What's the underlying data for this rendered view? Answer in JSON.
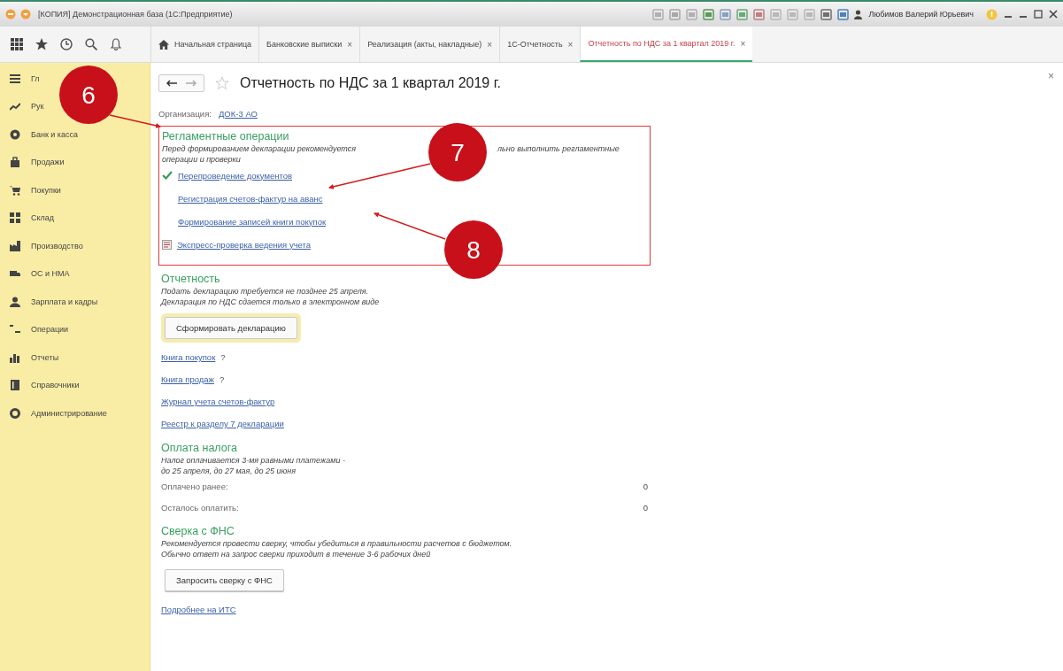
{
  "window": {
    "title": "[КОПИЯ] Демонстрационная база (1С:Предприятие)",
    "user": "Любимов Валерий Юрьевич"
  },
  "tabs": [
    {
      "label": "Начальная страница",
      "home": true,
      "closable": false,
      "selected": false
    },
    {
      "label": "Банковские выписки",
      "home": false,
      "closable": true,
      "selected": false
    },
    {
      "label": "Реализация (акты, накладные)",
      "home": false,
      "closable": true,
      "selected": false
    },
    {
      "label": "1С-Отчетность",
      "home": false,
      "closable": true,
      "selected": false
    },
    {
      "label": "Отчетность по НДС за 1 квартал 2019 г.",
      "home": false,
      "closable": true,
      "selected": true
    }
  ],
  "close_mark": "×",
  "sidebar": {
    "items": [
      {
        "label": "Гл"
      },
      {
        "label": "Рук"
      },
      {
        "label": "Банк и касса"
      },
      {
        "label": "Продажи"
      },
      {
        "label": "Покупки"
      },
      {
        "label": "Склад"
      },
      {
        "label": "Производство"
      },
      {
        "label": "ОС и НМА"
      },
      {
        "label": "Зарплата и кадры"
      },
      {
        "label": "Операции"
      },
      {
        "label": "Отчеты"
      },
      {
        "label": "Справочники"
      },
      {
        "label": "Администрирование"
      }
    ]
  },
  "form": {
    "title": "Отчетность по НДС за 1 квартал 2019 г.",
    "organization_label": "Организация:",
    "organization": "ДОК-3 АО",
    "sections": [
      {
        "heading": "Регламентные операции",
        "highlighted": true,
        "lines": [
          [
            "Перед формированием декларации рекомендуется",
            "льно выполнить регламентные"
          ],
          [
            "операции и проверки"
          ]
        ],
        "items": [
          {
            "kind": "done",
            "label": "Перепроведение документов"
          },
          {
            "kind": "pending",
            "label": "Регистрация счетов-фактур на аванс"
          },
          {
            "kind": "pending",
            "label": "Формирование записей книги покупок"
          },
          {
            "kind": "report",
            "label": "Экспресс-проверка ведения учета"
          }
        ]
      },
      {
        "heading": "Отчетность",
        "highlighted": false,
        "lines": [
          [
            "Подать декларацию требуется не позднее 25 апреля."
          ],
          [
            "Декларация по НДС сдается только в электронном виде"
          ]
        ],
        "items": [
          {
            "kind": "button",
            "label": "Сформировать декларацию",
            "default": true
          },
          {
            "kind": "link",
            "label": "Книга покупок",
            "help": "?"
          },
          {
            "kind": "link",
            "label": "Книга продаж",
            "help": "?"
          },
          {
            "kind": "link",
            "label": "Журнал учета счетов-фактур"
          },
          {
            "kind": "link",
            "label": "Реестр к разделу 7 декларации"
          }
        ]
      },
      {
        "heading": "Оплата налога",
        "highlighted": false,
        "lines": [
          [
            "Налог оплачивается 3-мя равными платежами -"
          ],
          [
            "до 25 апреля, до 27 мая, до 25 июня"
          ]
        ],
        "items": [
          {
            "kind": "amount",
            "label": "Оплачено ранее:",
            "value": "0"
          },
          {
            "kind": "amount",
            "label": "Осталось оплатить:",
            "value": "0"
          }
        ]
      },
      {
        "heading": "Сверка с ФНС",
        "highlighted": false,
        "lines": [
          [
            "Рекомендуется провести сверку, чтобы убедиться в правильности расчетов с бюджетом."
          ],
          [
            "Обычно ответ на запрос сверки приходит в течение 3-6 рабочих дней"
          ]
        ],
        "items": [
          {
            "kind": "button",
            "label": "Запросить сверку с ФНС",
            "default": false
          },
          {
            "kind": "link",
            "label": "Подробнее на ИТС"
          }
        ]
      }
    ]
  },
  "annotations": [
    {
      "number": "6"
    },
    {
      "number": "7"
    },
    {
      "number": "8"
    }
  ]
}
